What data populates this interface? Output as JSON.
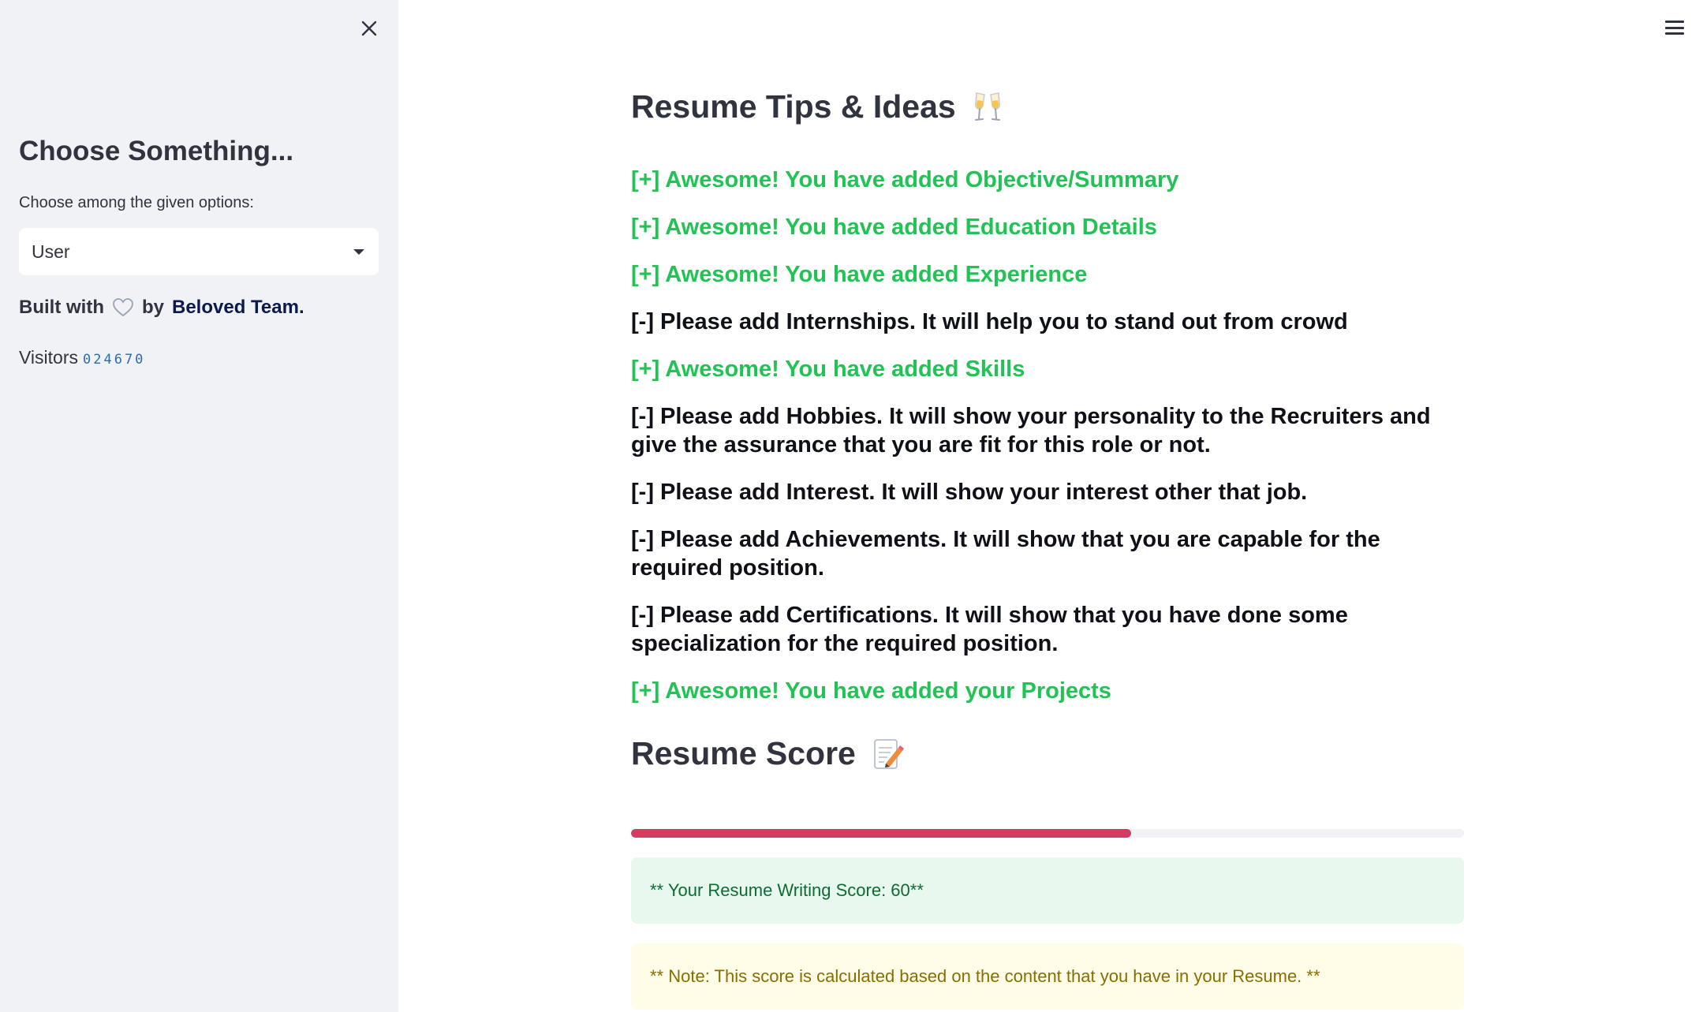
{
  "sidebar": {
    "title": "Choose Something...",
    "select_label": "Choose among the given options:",
    "select_value": "User",
    "built_prefix": "Built with",
    "built_by": "by",
    "team_name": "Beloved Team.",
    "visitors_label": "Visitors",
    "visitors_count": "024670"
  },
  "main": {
    "tips_heading": "Resume Tips & Ideas",
    "tips": [
      {
        "text": "[+] Awesome! You have added Objective/Summary",
        "status": "good"
      },
      {
        "text": "[+] Awesome! You have added Education Details",
        "status": "good"
      },
      {
        "text": "[+] Awesome! You have added Experience",
        "status": "good"
      },
      {
        "text": "[-] Please add Internships. It will help you to stand out from crowd",
        "status": "bad"
      },
      {
        "text": "[+] Awesome! You have added Skills",
        "status": "good"
      },
      {
        "text": "[-] Please add Hobbies. It will show your personality to the Recruiters and give the assurance that you are fit for this role or not.",
        "status": "bad"
      },
      {
        "text": "[-] Please add Interest. It will show your interest other that job.",
        "status": "bad"
      },
      {
        "text": "[-] Please add Achievements. It will show that you are capable for the required position.",
        "status": "bad"
      },
      {
        "text": "[-] Please add Certifications. It will show that you have done some specialization for the required position.",
        "status": "bad"
      },
      {
        "text": "[+] Awesome! You have added your Projects",
        "status": "good"
      }
    ],
    "score_heading": "Resume Score",
    "score_progress_percent": 60,
    "score_text": "** Your Resume Writing Score: 60**",
    "note_text": "** Note: This score is calculated based on the content that you have in your Resume. **"
  },
  "colors": {
    "good": "#21c354",
    "bad": "#0e1117",
    "progress": "#d33c5f",
    "sidebar_bg": "#f0f2f6"
  },
  "icons": {
    "close": "close-icon",
    "menu": "hamburger-menu-icon",
    "heart": "heart-icon",
    "glasses": "clinking-glasses-icon",
    "memo": "memo-icon"
  }
}
